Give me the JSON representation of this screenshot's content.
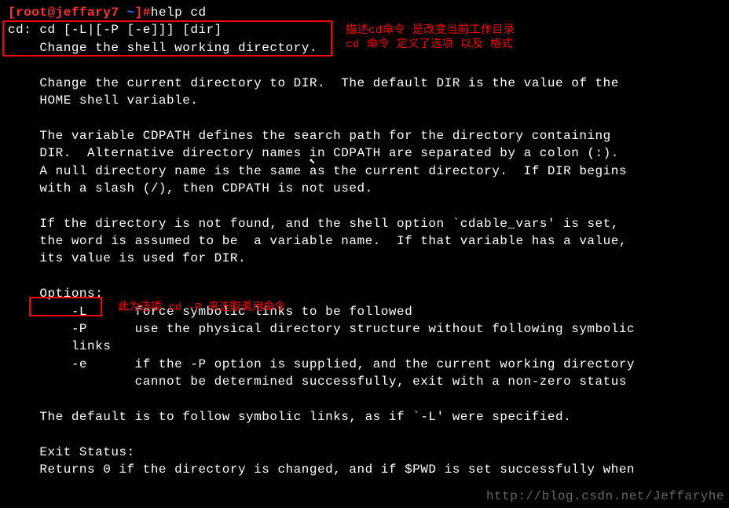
{
  "prompt": {
    "user": "[root@jeffary7 ",
    "dir": "~",
    "suffix": "]#",
    "command": "help cd"
  },
  "help": {
    "usage": "cd: cd [-L|[-P [-e]]] [dir]",
    "summary": "    Change the shell working directory.",
    "blank": "    ",
    "desc1": "    Change the current directory to DIR.  The default DIR is the value of the",
    "desc2": "    HOME shell variable.",
    "desc3": "    The variable CDPATH defines the search path for the directory containing",
    "desc4": "    DIR.  Alternative directory names in CDPATH are separated by a colon (:).",
    "desc5": "    A null directory name is the same as the current directory.  If DIR begins",
    "desc6": "    with a slash (/), then CDPATH is not used.",
    "desc7": "    If the directory is not found, and the shell option `cdable_vars' is set,",
    "desc8": "    the word is assumed to be  a variable name.  If that variable has a value,",
    "desc9": "    its value is used for DIR.",
    "opt_header": "    Options:",
    "optL": "        -L      force symbolic links to be followed",
    "optP": "        -P      use the physical directory structure without following symbolic",
    "optP2": "        links",
    "opte": "        -e      if the -P option is supplied, and the current working directory",
    "opte2": "                cannot be determined successfully, exit with a non-zero status",
    "default_line": "    The default is to follow symbolic links, as if `-L' were specified.",
    "exit_header": "    Exit Status:",
    "exit_line": "    Returns 0 if the directory is changed, and if $PWD is set successfully when"
  },
  "annotations": {
    "line1a": "描述cd命令 是改变当前工作目录",
    "line1b": "cd 命令 定义了选项 以及 格式",
    "line2": "此为选项 cd -P 来选取调用命令"
  },
  "watermark": "http://blog.csdn.net/Jeffaryhe"
}
